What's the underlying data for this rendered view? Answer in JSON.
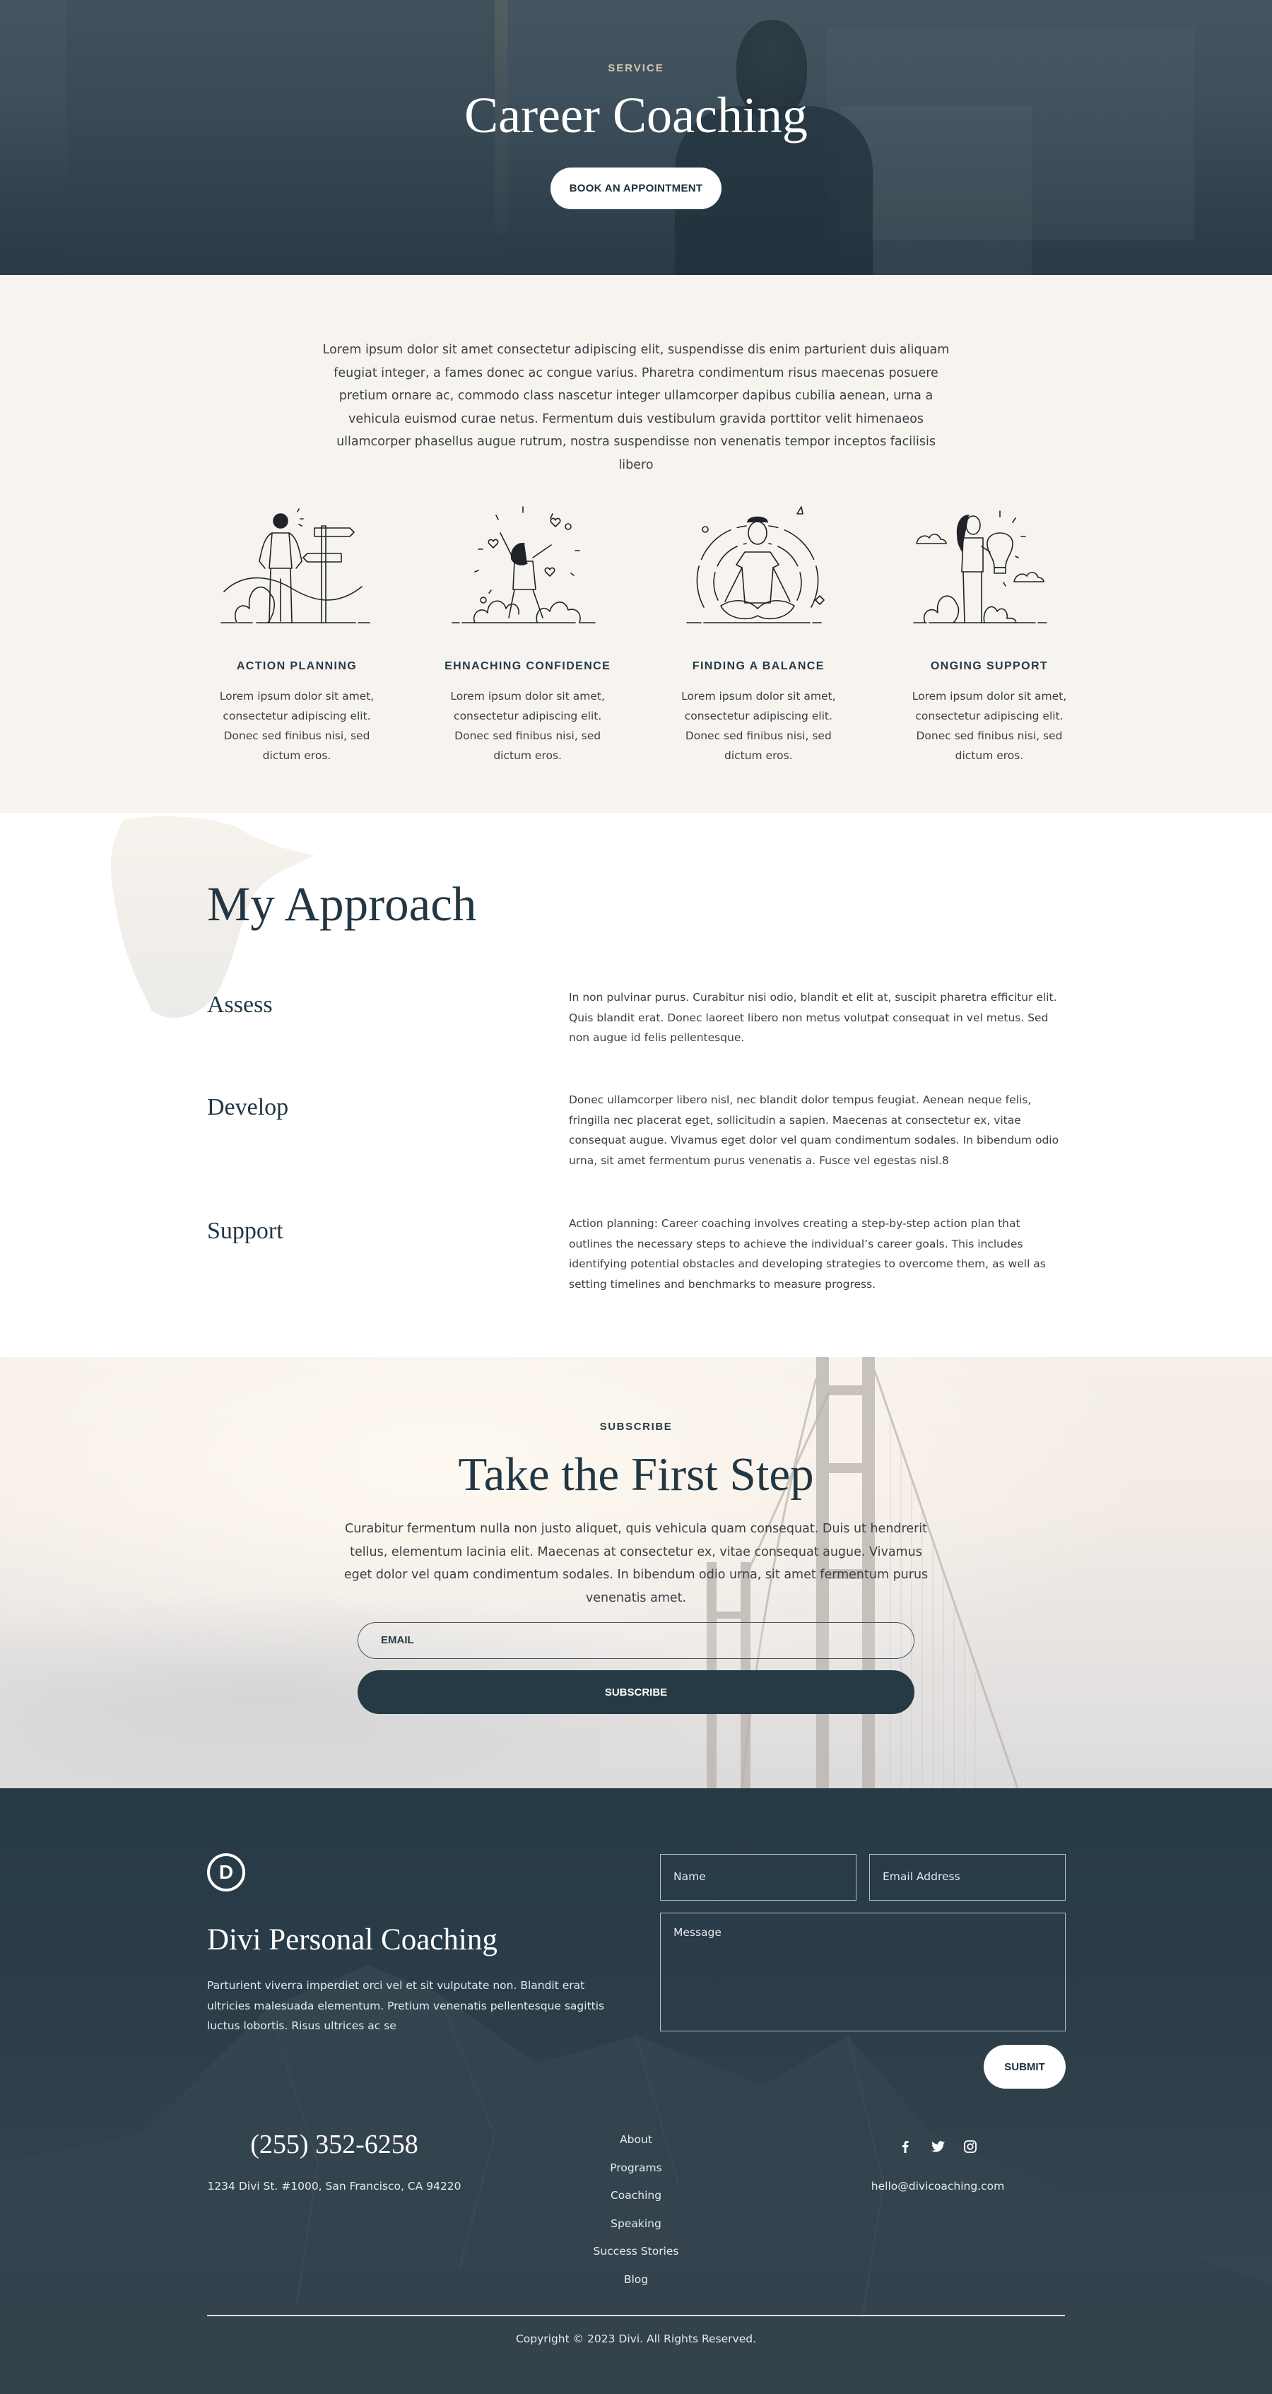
{
  "colors": {
    "navy": "#263a46",
    "cream": "#f7f4f0",
    "eyebrow_gold": "#cfc7b2",
    "white": "#ffffff"
  },
  "hero": {
    "eyebrow": "SERVICE",
    "title": "Career Coaching",
    "cta_label": "BOOK AN APPOINTMENT"
  },
  "intro": {
    "text": "Lorem ipsum dolor sit amet consectetur adipiscing elit, suspendisse dis enim parturient duis aliquam feugiat integer, a fames donec ac congue varius. Pharetra condimentum risus maecenas posuere pretium ornare ac, commodo class nascetur integer ullamcorper dapibus cubilia aenean, urna a vehicula euismod curae netus. Fermentum duis vestibulum gravida porttitor velit himenaeos ullamcorper phasellus augue rutrum, nostra suspendisse non venenatis tempor inceptos facilisis libero"
  },
  "features": [
    {
      "illustration": "man-at-signpost",
      "title": "ACTION PLANNING",
      "text": "Lorem ipsum dolor sit amet, consectetur adipiscing elit. Donec sed finibus nisi, sed dictum eros."
    },
    {
      "illustration": "woman-jumping-with-hearts",
      "title": "EHNACHING CONFIDENCE",
      "text": "Lorem ipsum dolor sit amet, consectetur adipiscing elit. Donec sed finibus nisi, sed dictum eros."
    },
    {
      "illustration": "man-meditating",
      "title": "FINDING A BALANCE",
      "text": "Lorem ipsum dolor sit amet, consectetur adipiscing elit. Donec sed finibus nisi, sed dictum eros."
    },
    {
      "illustration": "woman-holding-lightbulb",
      "title": "ONGING SUPPORT",
      "text": "Lorem ipsum dolor sit amet, consectetur adipiscing elit. Donec sed finibus nisi, sed dictum eros."
    }
  ],
  "approach": {
    "title": "My Approach",
    "steps": [
      {
        "heading": "Assess",
        "text": "In non pulvinar purus. Curabitur nisi odio, blandit et elit at, suscipit pharetra efficitur elit. Quis blandit erat. Donec laoreet libero non metus volutpat consequat in vel metus. Sed non augue id felis pellentesque."
      },
      {
        "heading": "Develop",
        "text": "Donec ullamcorper libero nisl, nec blandit dolor tempus feugiat. Aenean neque felis, fringilla nec placerat eget, sollicitudin a sapien. Maecenas at consectetur ex, vitae consequat augue. Vivamus eget dolor vel quam condimentum sodales. In bibendum odio urna, sit amet fermentum purus venenatis a. Fusce vel egestas nisl.8"
      },
      {
        "heading": "Support",
        "text": "Action planning: Career coaching involves creating a step-by-step action plan that outlines the necessary steps to achieve the individual’s career goals. This includes identifying potential obstacles and developing strategies to overcome them, as well as setting timelines and benchmarks to measure progress."
      }
    ]
  },
  "subscribe": {
    "eyebrow": "SUBSCRIBE",
    "title": "Take the First Step",
    "text": "Curabitur fermentum nulla non justo aliquet, quis vehicula quam consequat. Duis ut hendrerit tellus, elementum lacinia elit. Maecenas at consectetur ex, vitae consequat augue. Vivamus eget dolor vel quam condimentum sodales. In bibendum odio urna, sit amet fermentum purus venenatis amet.",
    "email_placeholder": "EMAIL",
    "button_label": "SUBSCRIBE"
  },
  "footer": {
    "logo_letter": "D",
    "brand": "Divi Personal Coaching",
    "brand_text": "Parturient viverra imperdiet orci vel et sit vulputate non. Blandit erat ultricies malesuada elementum. Pretium venenatis pellentesque sagittis luctus lobortis. Risus ultrices ac se",
    "form": {
      "name_placeholder": "Name",
      "email_placeholder": "Email Address",
      "message_placeholder": "Message",
      "submit_label": "SUBMIT"
    },
    "phone": "(255) 352-6258",
    "address": "1234 Divi St. #1000, San Francisco, CA 94220",
    "nav": [
      "About",
      "Programs",
      "Coaching",
      "Speaking",
      "Success Stories",
      "Blog"
    ],
    "social": [
      "facebook-icon",
      "twitter-icon",
      "instagram-icon"
    ],
    "email": "hello@divicoaching.com",
    "copyright": "Copyright © 2023 Divi. All Rights Reserved."
  }
}
